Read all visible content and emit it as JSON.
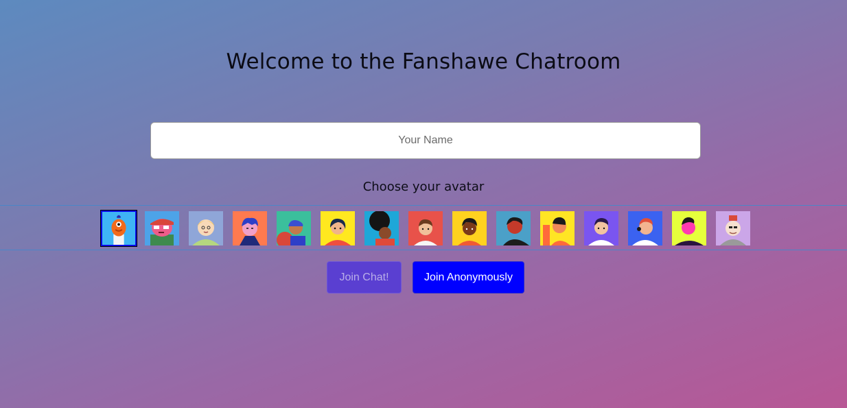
{
  "header": {
    "title": "Welcome to the Fanshawe Chatroom"
  },
  "name_field": {
    "placeholder": "Your Name",
    "value": ""
  },
  "avatar_section": {
    "label": "Choose your avatar",
    "selected_index": 0,
    "avatars": [
      {
        "name": "avatar-1-orange-bird",
        "bg": "#3fb4f5",
        "accent": "#f26a1b"
      },
      {
        "name": "avatar-2-pink-cap",
        "bg": "#4da3e8",
        "accent": "#ee5d8a"
      },
      {
        "name": "avatar-3-blonde-green",
        "bg": "#8fa6d8",
        "accent": "#b5d77f"
      },
      {
        "name": "avatar-4-blue-hair",
        "bg": "#ff7a4f",
        "accent": "#2e3fc8"
      },
      {
        "name": "avatar-5-blue-cap",
        "bg": "#3bbf9c",
        "accent": "#d9473a"
      },
      {
        "name": "avatar-6-dark-hair-yellow",
        "bg": "#ffe81f",
        "accent": "#ef4e3f"
      },
      {
        "name": "avatar-7-afro",
        "bg": "#1ea7d8",
        "accent": "#141414"
      },
      {
        "name": "avatar-8-brown-hair",
        "bg": "#e8524a",
        "accent": "#f5f5f5"
      },
      {
        "name": "avatar-9-curly-yellow",
        "bg": "#ffd21f",
        "accent": "#f05a33"
      },
      {
        "name": "avatar-10-dark-figure",
        "bg": "#4ba0c8",
        "accent": "#1d1d1d"
      },
      {
        "name": "avatar-11-yellow-wave",
        "bg": "#ffe524",
        "accent": "#ff6a3a"
      },
      {
        "name": "avatar-12-purple-bg",
        "bg": "#7a55f0",
        "accent": "#ffffff"
      },
      {
        "name": "avatar-13-blue-headset",
        "bg": "#3b62f0",
        "accent": "#ffffff"
      },
      {
        "name": "avatar-14-lime-profile",
        "bg": "#e6ff3c",
        "accent": "#2a1440"
      },
      {
        "name": "avatar-15-grey-suit",
        "bg": "#cba6e8",
        "accent": "#9a9a9a"
      }
    ]
  },
  "actions": {
    "join_label": "Join Chat!",
    "anon_label": "Join Anonymously"
  }
}
